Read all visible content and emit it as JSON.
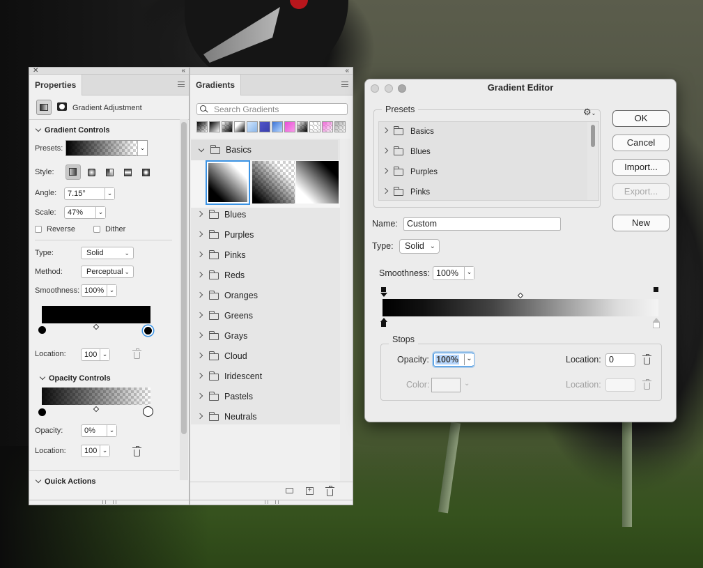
{
  "properties": {
    "tab": "Properties",
    "adjustment_label": "Gradient Adjustment",
    "gradient_controls": {
      "title": "Gradient Controls",
      "presets_label": "Presets:",
      "style_label": "Style:",
      "angle_label": "Angle:",
      "angle_value": "7.15°",
      "scale_label": "Scale:",
      "scale_value": "47%",
      "reverse_label": "Reverse",
      "dither_label": "Dither",
      "type_label": "Type:",
      "type_value": "Solid",
      "method_label": "Method:",
      "method_value": "Perceptual",
      "smoothness_label": "Smoothness:",
      "smoothness_value": "100%",
      "location_label": "Location:",
      "location_value": "100"
    },
    "opacity_controls": {
      "title": "Opacity Controls",
      "opacity_label": "Opacity:",
      "opacity_value": "0%",
      "location_label": "Location:",
      "location_value": "100"
    },
    "quick_actions": "Quick Actions"
  },
  "gradients": {
    "tab": "Gradients",
    "search_placeholder": "Search Gradients",
    "expanded_group": "Basics",
    "groups": [
      "Blues",
      "Purples",
      "Pinks",
      "Reds",
      "Oranges",
      "Greens",
      "Grays",
      "Cloud",
      "Iridescent",
      "Pastels",
      "Neutrals"
    ]
  },
  "editor": {
    "title": "Gradient Editor",
    "presets_label": "Presets",
    "preset_folders": [
      "Basics",
      "Blues",
      "Purples",
      "Pinks"
    ],
    "buttons": {
      "ok": "OK",
      "cancel": "Cancel",
      "import": "Import...",
      "export": "Export...",
      "new": "New"
    },
    "name_label": "Name:",
    "name_value": "Custom",
    "type_label": "Type:",
    "type_value": "Solid",
    "smoothness_label": "Smoothness:",
    "smoothness_value": "100%",
    "stops": {
      "title": "Stops",
      "opacity_label": "Opacity:",
      "opacity_value": "100%",
      "location_label": "Location:",
      "location_value": "0",
      "color_label": "Color:",
      "color_location_label": "Location:",
      "color_location_value": ""
    }
  },
  "colors": {
    "selection": "#3b93e4",
    "dialog_bg": "#ececec",
    "panel_bg": "#f0f0f0"
  }
}
